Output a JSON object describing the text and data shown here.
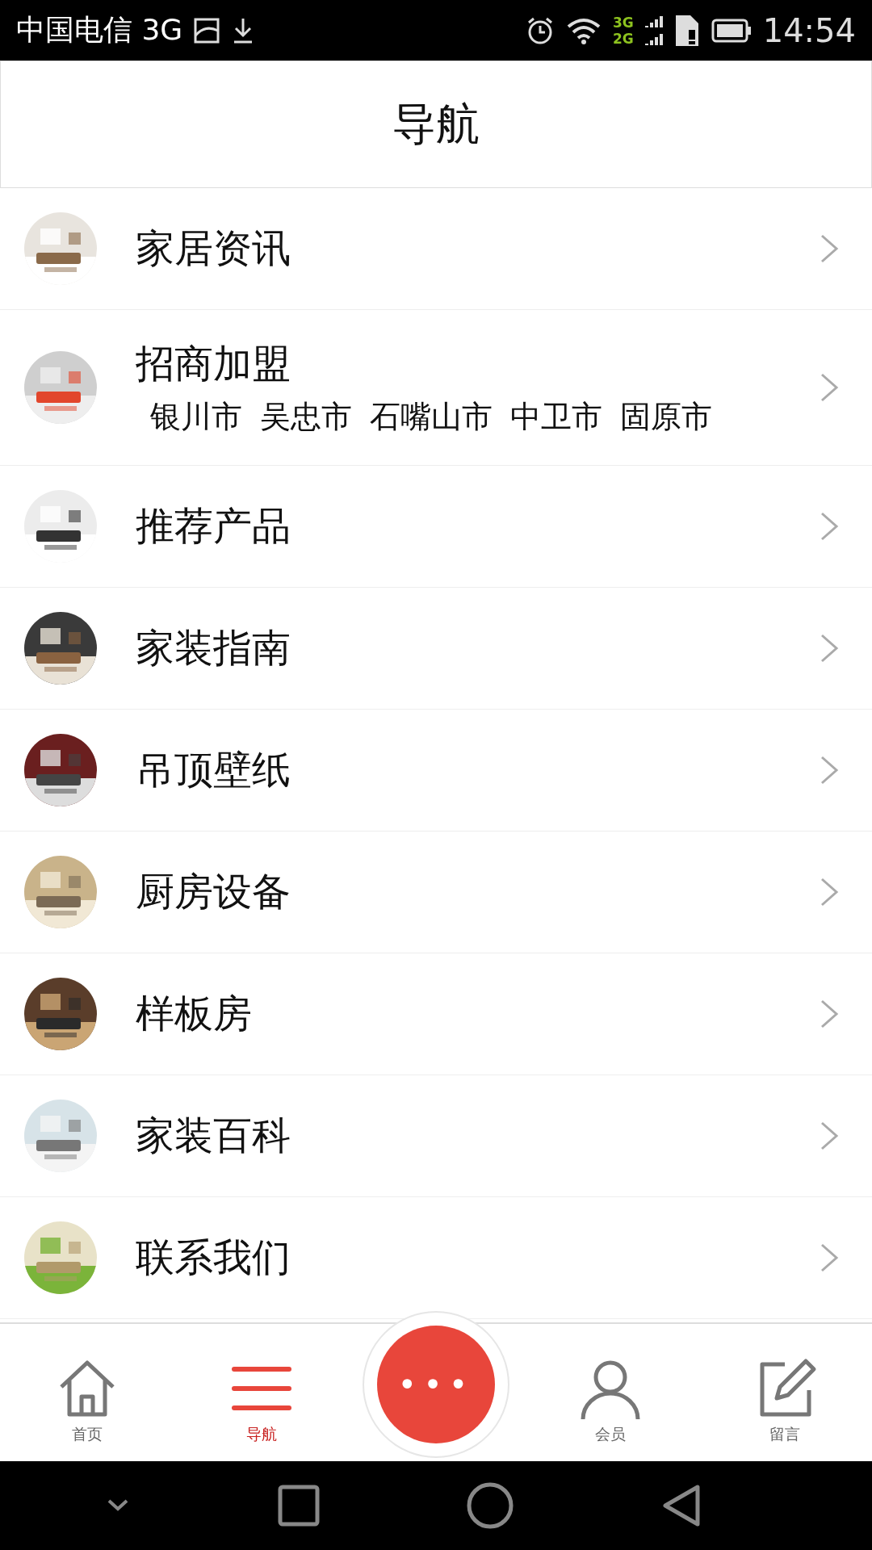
{
  "status_bar": {
    "carrier": "中国电信 3G",
    "network_top": "3G",
    "network_bottom": "2G",
    "time": "14:54"
  },
  "header": {
    "title": "导航"
  },
  "items": [
    {
      "title": "家居资讯",
      "kind": "picture"
    },
    {
      "title": "招商加盟",
      "kind": "picture",
      "cities": [
        "银川市",
        "吴忠市",
        "石嘴山市",
        "中卫市",
        "固原市"
      ]
    },
    {
      "title": "推荐产品",
      "kind": "picture"
    },
    {
      "title": "家装指南",
      "kind": "picture"
    },
    {
      "title": "吊顶壁纸",
      "kind": "picture"
    },
    {
      "title": "厨房设备",
      "kind": "picture"
    },
    {
      "title": "样板房",
      "kind": "picture"
    },
    {
      "title": "家装百科",
      "kind": "picture"
    },
    {
      "title": "联系我们",
      "kind": "picture"
    }
  ],
  "tab_bar": {
    "tabs": [
      {
        "label": "首页",
        "kind": "home",
        "selected": false
      },
      {
        "label": "导航",
        "kind": "menu",
        "selected": true
      },
      {
        "label": "会员",
        "kind": "user",
        "selected": false
      },
      {
        "label": "留言",
        "kind": "edit",
        "selected": false
      }
    ],
    "center_button": "•••"
  }
}
